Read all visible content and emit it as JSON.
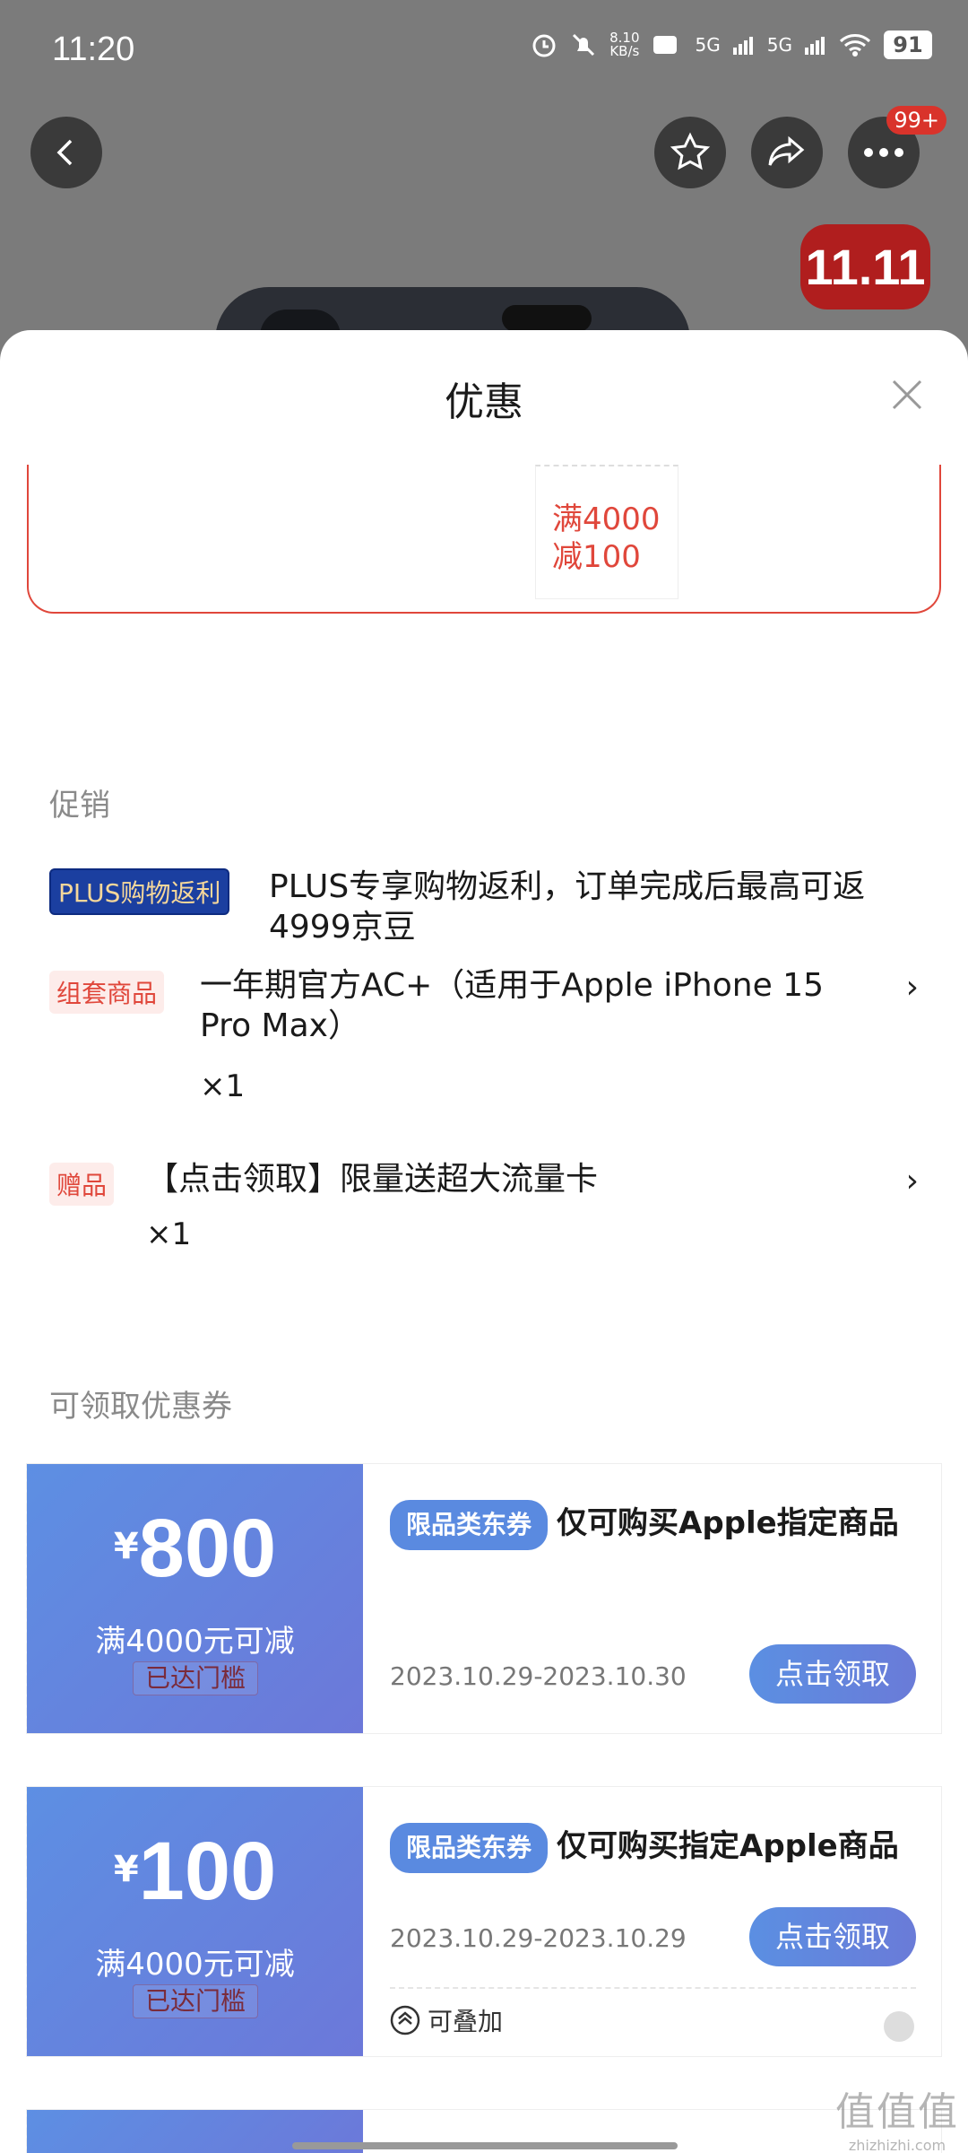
{
  "status_bar": {
    "time": "11:20",
    "net_speed_value": "8.10",
    "net_speed_unit": "KB/s",
    "signal_1": "5G",
    "signal_2": "5G",
    "battery": "91"
  },
  "top_actions": {
    "cart_badge": "99+"
  },
  "sheet": {
    "title": "优惠",
    "previous_ticket": "满4000\n减100",
    "promotions_label": "促销",
    "promotions": [
      {
        "tag": "PLUS购物返利",
        "text": "PLUS专享购物返利，订单完成后最高可返4999京豆"
      },
      {
        "tag": "组套商品",
        "text": "一年期官方AC+（适用于Apple iPhone 15 Pro Max）",
        "qty": "×1"
      },
      {
        "tag": "赠品",
        "text": "【点击领取】限量送超大流量卡",
        "qty": "×1"
      }
    ],
    "coupons_label": "可领取优惠券",
    "coupons": [
      {
        "currency": "¥",
        "amount": "800",
        "condition": "满4000元可减",
        "status": "已达门槛",
        "tag": "限品类东券",
        "title": "仅可购买Apple指定商品",
        "date": "2023.10.29-2023.10.30",
        "button": "点击领取"
      },
      {
        "currency": "¥",
        "amount": "100",
        "condition": "满4000元可减",
        "status": "已达门槛",
        "tag": "限品类东券",
        "title": "仅可购买指定Apple商品",
        "date": "2023.10.29-2023.10.29",
        "button": "点击领取",
        "stackable": "可叠加"
      }
    ]
  },
  "watermark": {
    "text": "值值值",
    "site": "zhizhizhi.com"
  },
  "colors": {
    "accent_red": "#e0473b",
    "coupon_blue": "#5d8fe3",
    "plus_tag": "#1b3fa0"
  }
}
